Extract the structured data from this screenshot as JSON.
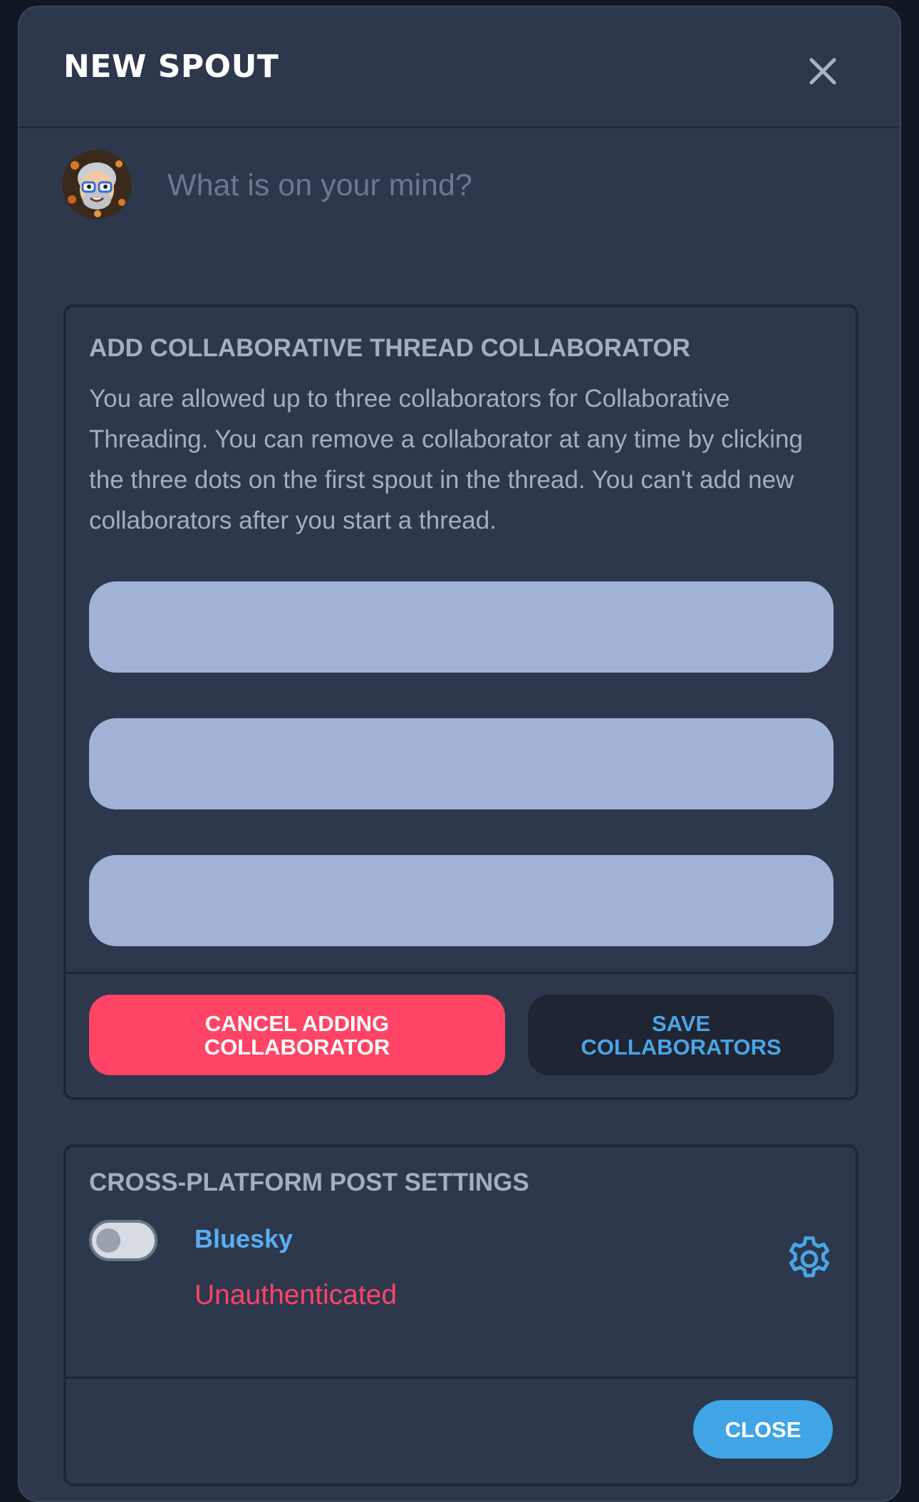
{
  "modal": {
    "title": "NEW SPOUT",
    "close_icon": "close-icon"
  },
  "composer": {
    "avatar_icon": "user-avatar",
    "placeholder": "What is on your mind?"
  },
  "collaborators": {
    "heading": "ADD COLLABORATIVE THREAD COLLABORATOR",
    "description": "You are allowed up to three collaborators for Collaborative Threading. You can remove a collaborator at any time by clicking the three dots on the first spout in the thread. You can't add new collaborators after you start a thread.",
    "inputs": [
      {
        "value": "",
        "placeholder": ""
      },
      {
        "value": "",
        "placeholder": ""
      },
      {
        "value": "",
        "placeholder": ""
      }
    ],
    "cancel_label": "CANCEL ADDING COLLABORATOR",
    "save_label": "SAVE COLLABORATORS"
  },
  "cross_platform": {
    "heading": "CROSS-PLATFORM POST SETTINGS",
    "platform": "Bluesky",
    "enabled": false,
    "status": "Unauthenticated",
    "settings_icon": "gear-icon",
    "close_label": "CLOSE"
  },
  "colors": {
    "background": "#2d384d",
    "accent": "#3fa5e6",
    "danger": "#ff4466",
    "input_fill": "#a0b3d6"
  }
}
